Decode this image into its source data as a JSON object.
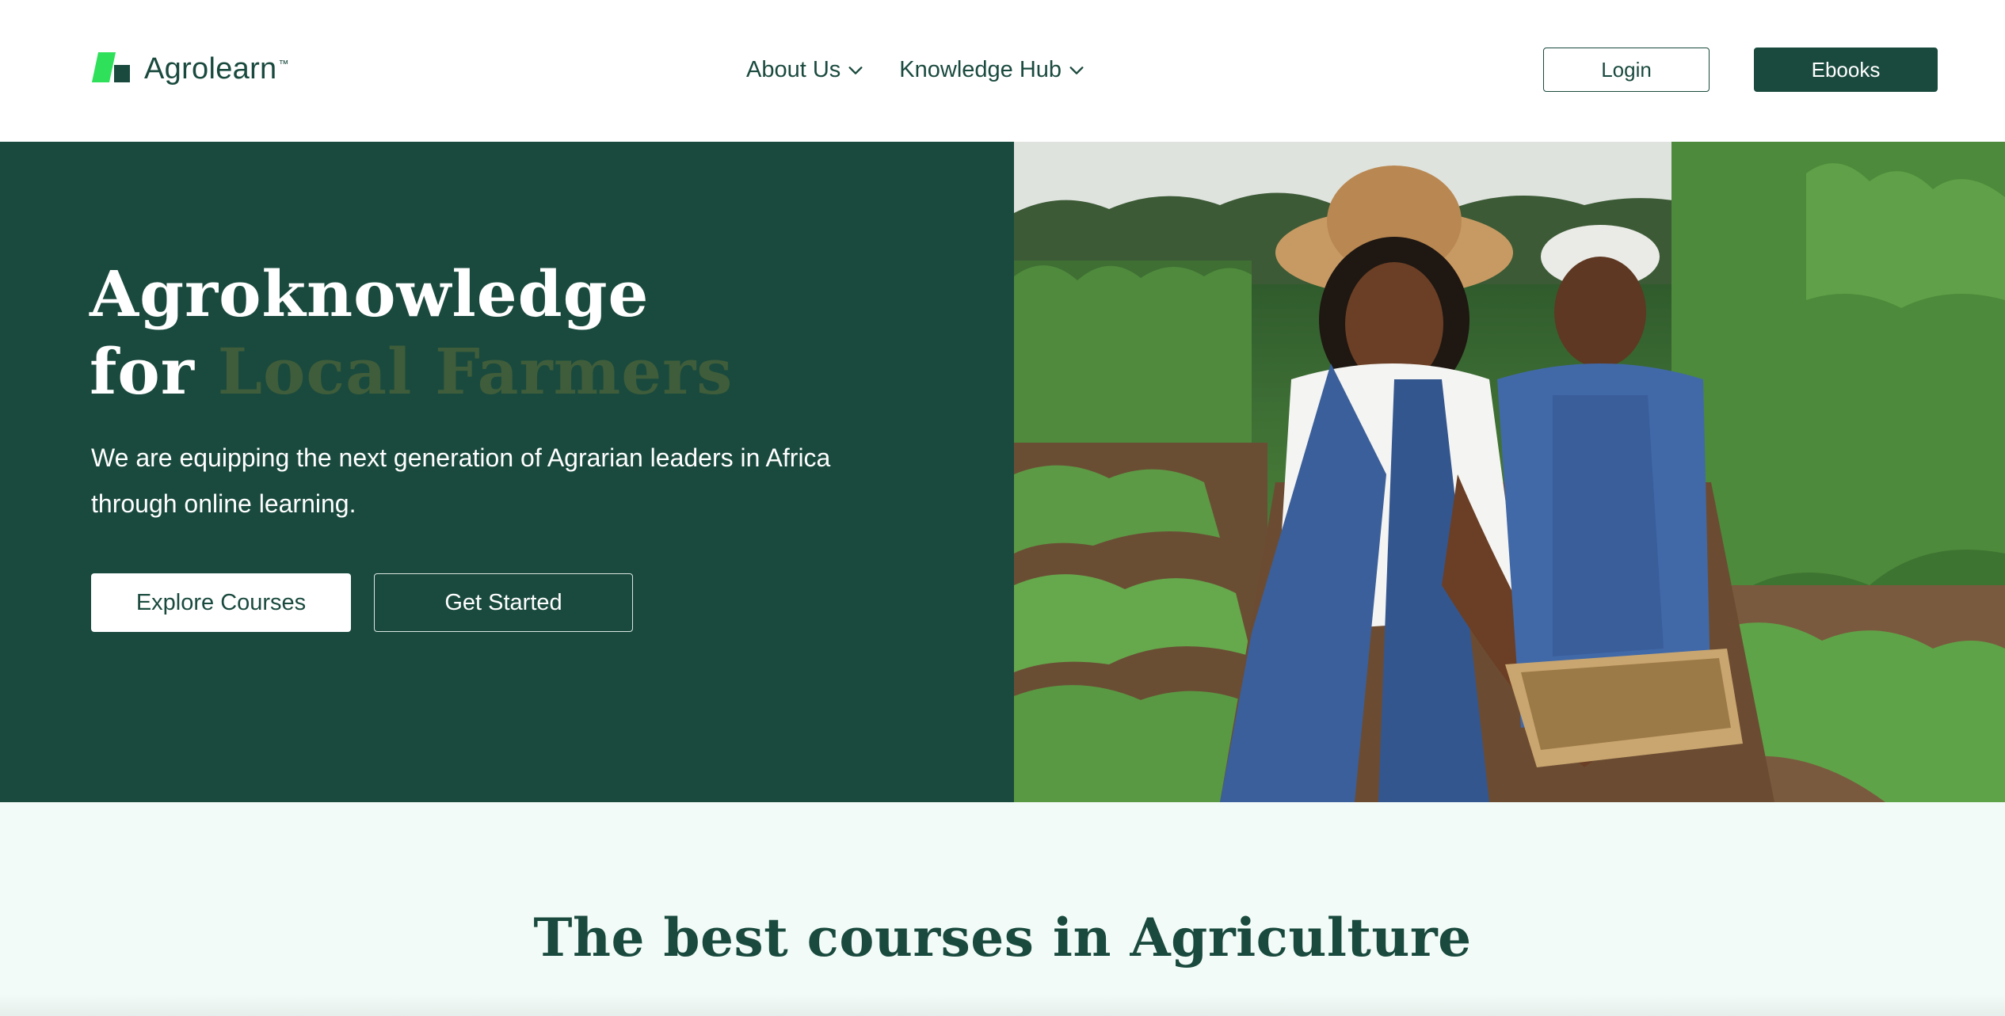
{
  "header": {
    "brand": "Agrolearn",
    "brand_tm": "™",
    "nav": [
      {
        "label": "About Us",
        "icon": "chevron-down-icon"
      },
      {
        "label": "Knowledge Hub",
        "icon": "chevron-down-icon"
      }
    ],
    "login_label": "Login",
    "ebooks_label": "Ebooks"
  },
  "hero": {
    "title_line1": "Agroknowledge",
    "title_for": "for",
    "title_accent": "Local Farmers",
    "subtitle": "We are equipping the next generation of Agrarian leaders in Africa through online learning.",
    "explore_label": "Explore Courses",
    "get_started_label": "Get Started"
  },
  "courses": {
    "title": "The best courses in Agriculture"
  },
  "colors": {
    "brand_dark": "#1a4a3e",
    "brand_green": "#2ee05a",
    "accent_olive": "#3f5d3a",
    "section_bg": "#f2fbf7"
  }
}
